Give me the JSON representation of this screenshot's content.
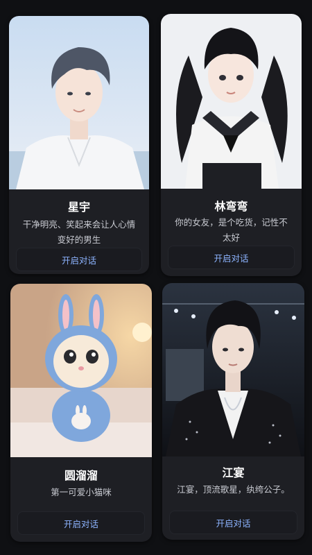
{
  "cards": [
    {
      "name": "星宇",
      "description": "干净明亮、笑起来会让人心情变好的男生",
      "button_label": "开启对话",
      "image_icon": "boy-portrait-image"
    },
    {
      "name": "林弯弯",
      "description": "你的女友，是个吃货，记性不太好",
      "button_label": "开启对话",
      "image_icon": "girl-sailor-uniform-image"
    },
    {
      "name": "圆溜溜",
      "description": "第一可爱小猫咪",
      "button_label": "开启对话",
      "image_icon": "kitten-bunny-costume-image"
    },
    {
      "name": "江宴",
      "description": "江宴，顶流歌星，纨绔公子。",
      "button_label": "开启对话",
      "image_icon": "male-singer-stage-image"
    }
  ],
  "colors": {
    "background": "#0f1013",
    "card": "#1e1f24",
    "accent": "#8db4ff",
    "text": "#ffffff",
    "subtext": "#c9cbd2"
  }
}
